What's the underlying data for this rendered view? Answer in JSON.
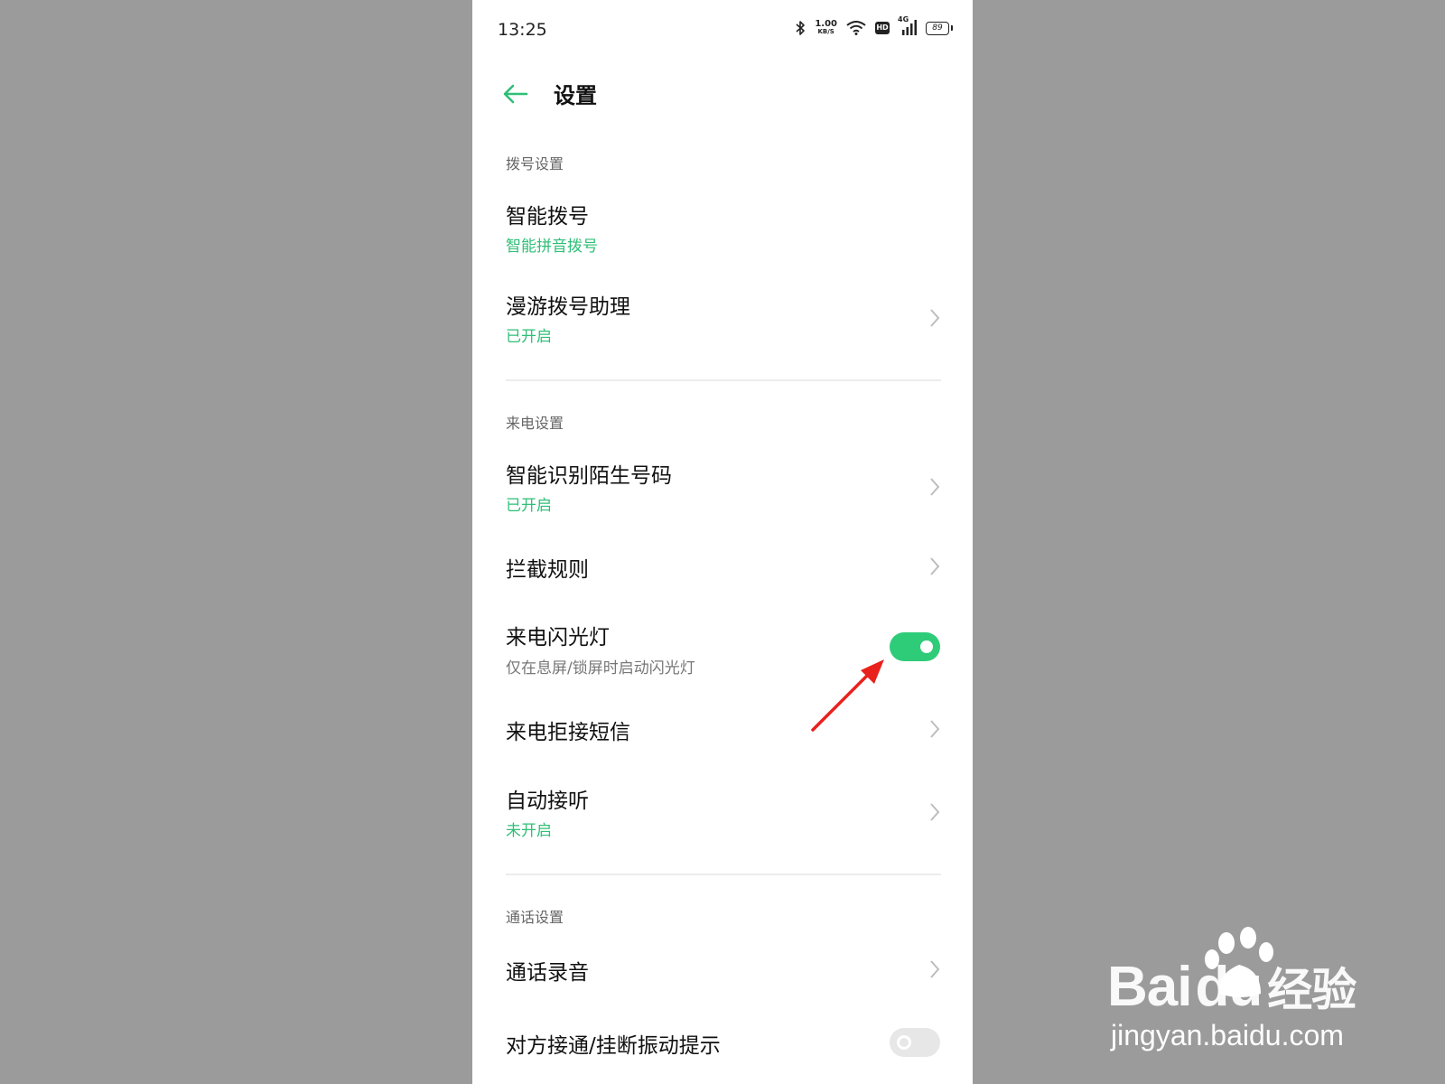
{
  "status_bar": {
    "time": "13:25",
    "net_speed_value": "1.00",
    "net_speed_unit": "KB/S",
    "hd_label": "HD",
    "signal_label": "4G",
    "battery_level": "89",
    "icons": [
      "bluetooth-icon",
      "wifi-icon",
      "hd-icon",
      "signal-icon",
      "battery-icon"
    ]
  },
  "header": {
    "title": "设置",
    "back_icon": "back-arrow-icon"
  },
  "sections": [
    {
      "title": "拨号设置",
      "items": [
        {
          "title": "智能拨号",
          "subtitle": "智能拼音拨号",
          "control": "none"
        },
        {
          "title": "漫游拨号助理",
          "subtitle": "已开启",
          "control": "chevron"
        }
      ]
    },
    {
      "title": "来电设置",
      "items": [
        {
          "title": "智能识别陌生号码",
          "subtitle": "已开启",
          "control": "chevron"
        },
        {
          "title": "拦截规则",
          "subtitle": "",
          "control": "chevron"
        },
        {
          "title": "来电闪光灯",
          "subtitle": "仅在息屏/锁屏时启动闪光灯",
          "control": "toggle",
          "toggle_on": true
        },
        {
          "title": "来电拒接短信",
          "subtitle": "",
          "control": "chevron"
        },
        {
          "title": "自动接听",
          "subtitle": "未开启",
          "control": "chevron"
        }
      ]
    },
    {
      "title": "通话设置",
      "items": [
        {
          "title": "通话录音",
          "subtitle": "",
          "control": "chevron"
        },
        {
          "title": "对方接通/挂断振动提示",
          "subtitle": "",
          "control": "toggle",
          "toggle_on": false
        }
      ]
    }
  ],
  "colors": {
    "accent": "#2fbf77",
    "toggle_on": "#2ecc79",
    "background": "#9b9b9b",
    "annotation_arrow": "#e8211d"
  },
  "watermark": {
    "logo_text_left": "Bai",
    "logo_text_mid": "du",
    "logo_text_right": "经验",
    "url": "jingyan.baidu.com"
  }
}
